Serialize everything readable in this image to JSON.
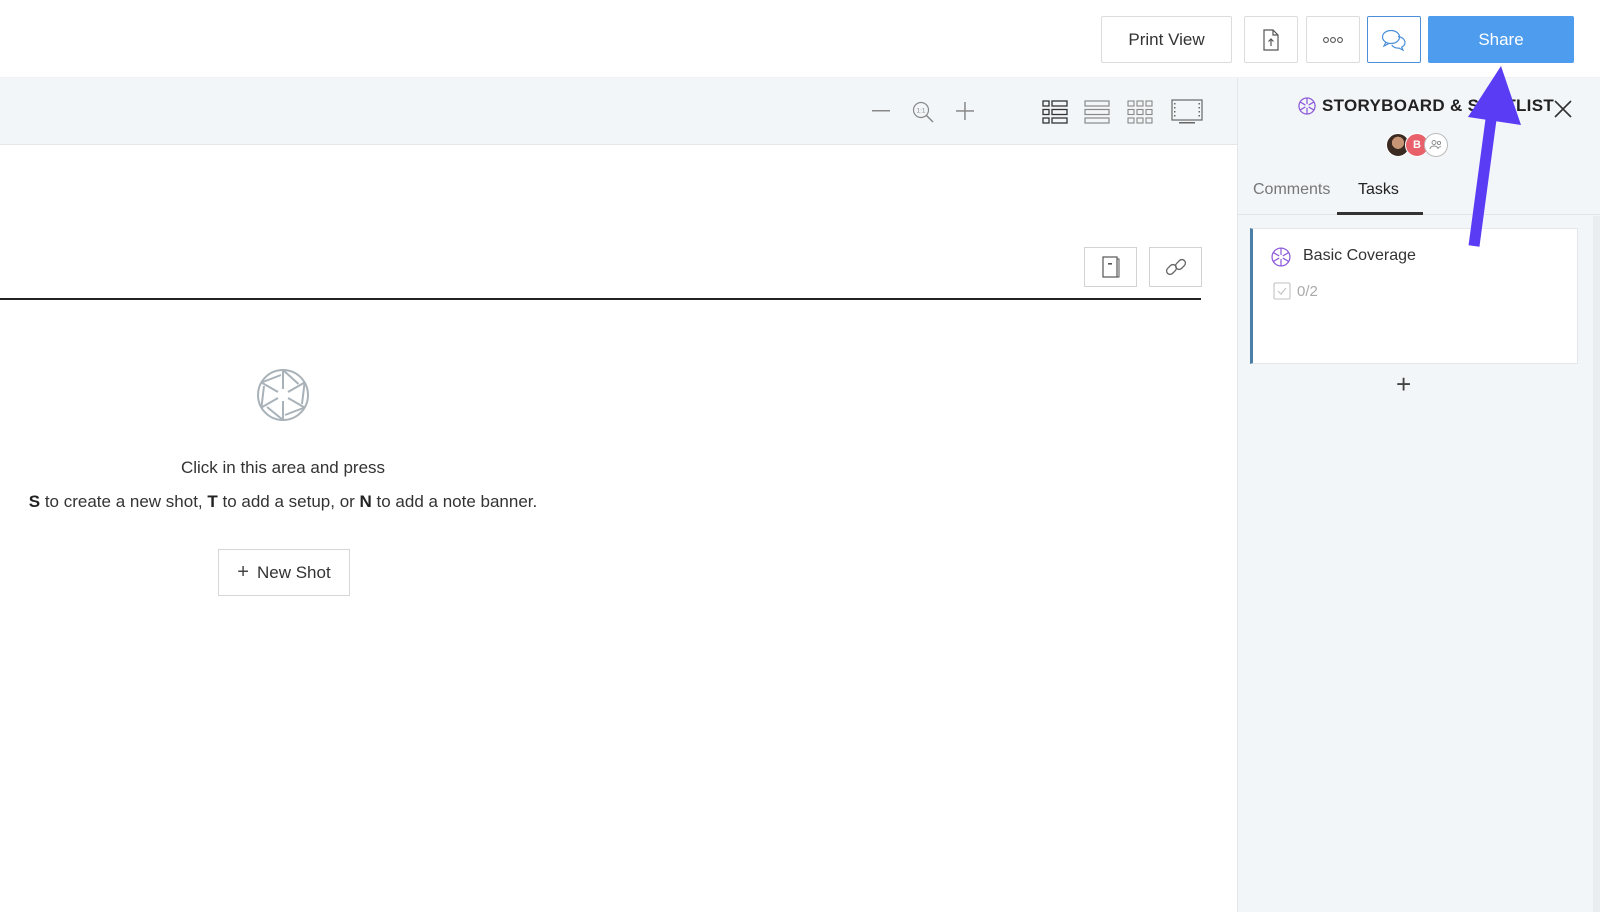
{
  "toolbar": {
    "print_view_label": "Print View",
    "export_icon": "file-export-icon",
    "more_icon": "more-dots-icon",
    "comments_icon": "speech-bubbles-icon",
    "share_label": "Share",
    "share_color": "#4d9cee"
  },
  "zoom_bar": {
    "zoom_out_icon": "minus-icon",
    "zoom_reset_icon": "zoom-1to1-icon",
    "zoom_in_icon": "plus-icon",
    "view_modes": [
      "list-detail-view-icon",
      "list-view-icon",
      "grid-view-icon",
      "filmstrip-view-icon"
    ]
  },
  "canvas": {
    "side_buttons": [
      "notebook-icon",
      "link-icon"
    ],
    "empty_icon": "aperture-icon",
    "hint_line1": "Click in this area and press",
    "hint_line2": {
      "k1": "S",
      "t1": " to create a new shot, ",
      "k2": "T",
      "t2": " to add a setup, or ",
      "k3": "N",
      "t3": " to add a note banner."
    },
    "new_shot_label": "New Shot",
    "new_shot_plus": "+"
  },
  "panel": {
    "title": "STORYBOARD & SHOTLIST",
    "title_icon_color": "#8e5cd9",
    "avatars": [
      {
        "type": "photo"
      },
      {
        "type": "initial",
        "label": "B",
        "color": "#e8606a"
      },
      {
        "type": "group"
      }
    ],
    "tabs": [
      {
        "label": "Comments",
        "active": false
      },
      {
        "label": "Tasks",
        "active": true
      }
    ],
    "tasks": [
      {
        "title": "Basic Coverage",
        "progress_text": "0/2",
        "done": 0,
        "total": 2
      }
    ],
    "add_task": "+"
  },
  "annotation": {
    "arrow_color": "#5b3cf5",
    "points_to": "share-button"
  }
}
